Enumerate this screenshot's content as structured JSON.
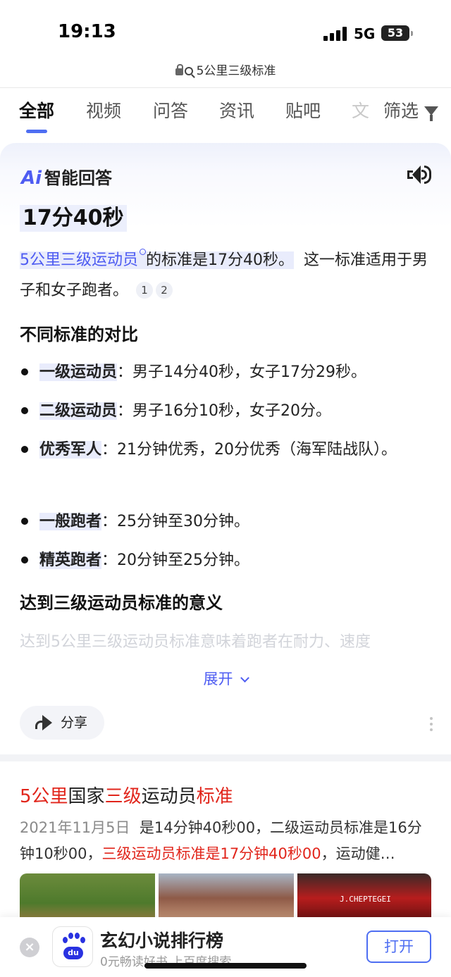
{
  "status_bar": {
    "time": "19:13",
    "network": "5G",
    "battery": "53"
  },
  "url_bar": {
    "query": "5公里三级标准"
  },
  "tabs": [
    {
      "label": "全部",
      "active": true
    },
    {
      "label": "视频"
    },
    {
      "label": "问答"
    },
    {
      "label": "资讯"
    },
    {
      "label": "贴吧"
    },
    {
      "label": "文"
    }
  ],
  "filter_label": "筛选",
  "ai_answer": {
    "logo": "Ai",
    "title": "智能回答",
    "headline": "17分40秒",
    "intro_link": "5公里三级运动员",
    "intro_bold": "的标准是17分40秒。",
    "intro_rest": "这一标准适用于男子和女子跑者。",
    "citations": [
      "1",
      "2"
    ],
    "section1_title": "不同标准的对比",
    "bullets": [
      {
        "term": "一级运动员",
        "text": "：男子14分40秒，女子17分29秒。"
      },
      {
        "term": "二级运动员",
        "text": "：男子16分10秒，女子20分。"
      },
      {
        "term": "优秀军人",
        "text": "：21分钟优秀，20分优秀（海军陆战队）。"
      },
      {
        "term": "一般跑者",
        "text": "：25分钟至30分钟。"
      },
      {
        "term": "精英跑者",
        "text": "：20分钟至25分钟。"
      }
    ],
    "section2_title": "达到三级运动员标准的意义",
    "faded_text": "达到5公里三级运动员标准意味着跑者在耐力、速度",
    "expand_label": "展开",
    "share_label": "分享"
  },
  "result": {
    "title_parts": [
      {
        "text": "5公里",
        "red": true
      },
      {
        "text": "国家",
        "red": false
      },
      {
        "text": "三级",
        "red": true
      },
      {
        "text": "运动员",
        "red": false
      },
      {
        "text": "标准",
        "red": true
      }
    ],
    "date": "2021年11月5日",
    "snippet_1": "是14分钟40秒00，二级运动员标准是16分钟10秒00，",
    "snippet_red": "三级运动员标准是17分钟40秒00",
    "snippet_2": "，运动健…",
    "thumb3_text": "J.CHEPTEGEI"
  },
  "banner": {
    "app_label": "du",
    "title": "玄幻小说排行榜",
    "subtitle": "0元畅读好书 上百度搜索",
    "open_label": "打开"
  },
  "colors": {
    "accent": "#4e6ef2",
    "link": "#4e5cf2",
    "red": "#e1251b"
  }
}
